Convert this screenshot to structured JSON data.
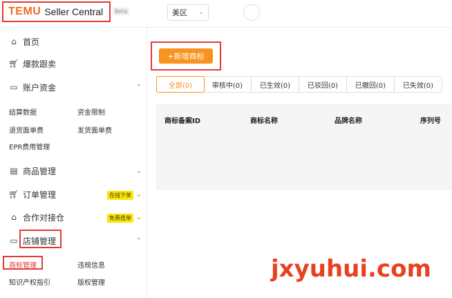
{
  "header": {
    "logo_brand": "TEMU",
    "logo_product": "Seller Central",
    "beta": "Beta",
    "region": "美区"
  },
  "sidebar": {
    "items": [
      {
        "label": "首页",
        "icon": "home-icon"
      },
      {
        "label": "爆款跟卖",
        "icon": "cart-icon"
      },
      {
        "label": "账户资金",
        "icon": "wallet-icon"
      },
      {
        "label": "商品管理",
        "icon": "product-icon"
      },
      {
        "label": "订单管理",
        "icon": "order-cart-icon"
      },
      {
        "label": "合作对接仓",
        "icon": "warehouse-icon"
      },
      {
        "label": "店铺管理",
        "icon": "store-icon"
      }
    ],
    "account_sub": [
      "结算数据",
      "资金限制",
      "退货面单费",
      "发货面单费",
      "EPR费用管理"
    ],
    "order_badge": "在线下单",
    "warehouse_badge": "免费揽单",
    "store_sub": [
      "商标管理",
      "违规信息",
      "知识产权指引",
      "版权管理"
    ]
  },
  "main": {
    "add_button": "+新增商标",
    "tabs": [
      "全部(0)",
      "审核中(0)",
      "已生效(0)",
      "已驳回(0)",
      "已撤回(0)",
      "已失效(0)"
    ],
    "columns": [
      "商标备案ID",
      "商标名称",
      "品牌名称",
      "序列号"
    ]
  },
  "watermark": "jxyuhui.com",
  "colors": {
    "accent": "#f7931e",
    "brand": "#f26b1d",
    "highlight": "#e53935",
    "badge": "#ffe600"
  }
}
